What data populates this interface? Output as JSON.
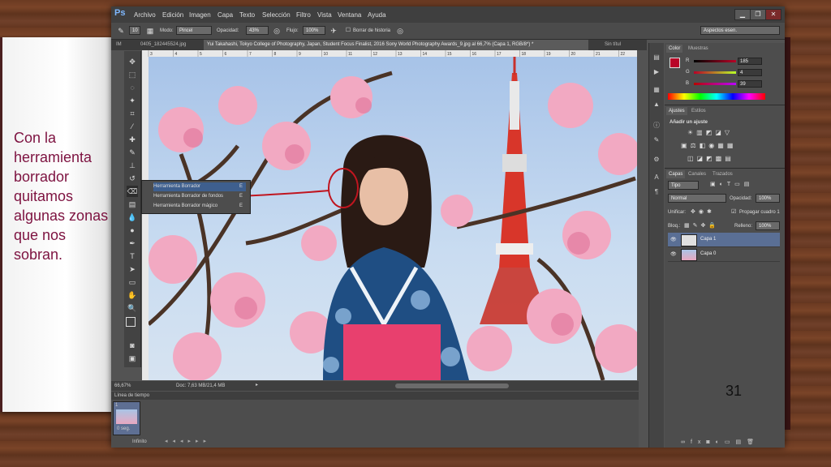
{
  "slide": {
    "text": "Con la herramienta borrador quitamos algunas zonas que nos sobran.",
    "page_number": "31"
  },
  "menu": {
    "logo": "Ps",
    "items": [
      "Archivo",
      "Edición",
      "Imagen",
      "Capa",
      "Texto",
      "Selección",
      "Filtro",
      "Vista",
      "Ventana",
      "Ayuda"
    ]
  },
  "options_bar": {
    "brush_size": "10",
    "modo_label": "Modo:",
    "modo_value": "Pincel",
    "opacidad_label": "Opacidad:",
    "opacidad_value": "43%",
    "flujo_label": "Flujo:",
    "flujo_value": "100%",
    "borrar_historia": "Borrar de historia",
    "workspace": "Aspectos esen."
  },
  "tabs": [
    {
      "label": "IM"
    },
    {
      "label": "0405_182445524.jpg"
    },
    {
      "label": "Yui Takahashi, Tokyo College of Photography, Japan, Student Focus Finalist, 2016 Sony World Photography Awards_9.jpg al 66,7% (Capa 1, RGB/8*) *"
    },
    {
      "label": "Sin títul"
    }
  ],
  "ruler_ticks": [
    "3",
    "4",
    "5",
    "6",
    "7",
    "8",
    "9",
    "10",
    "11",
    "12",
    "13",
    "14",
    "15",
    "16",
    "17",
    "18",
    "19",
    "20",
    "21",
    "22"
  ],
  "flyout": [
    {
      "label": "Herramienta Borrador",
      "key": "E"
    },
    {
      "label": "Herramienta Borrador de fondos",
      "key": "E"
    },
    {
      "label": "Herramienta Borrador mágico",
      "key": "E"
    }
  ],
  "status": {
    "zoom": "66,67%",
    "doc": "Doc: 7,63 MB/21,4 MB"
  },
  "timeline": {
    "title": "Línea de tiempo",
    "frame_number": "1",
    "frame_time": "0 seg.",
    "loop": "Infinito"
  },
  "color_panel": {
    "tabs": [
      "Color",
      "Muestras"
    ],
    "channels": [
      {
        "label": "R",
        "value": "185",
        "color": "#b90427"
      },
      {
        "label": "G",
        "value": "4",
        "color": "#04e04a"
      },
      {
        "label": "B",
        "value": "39",
        "color": "#2c2cff"
      }
    ]
  },
  "adjustments_panel": {
    "tabs": [
      "Ajustes",
      "Estilos"
    ],
    "title": "Añadir un ajuste"
  },
  "layers_panel": {
    "tabs": [
      "Capas",
      "Canales",
      "Trazados"
    ],
    "filter": "Tipo",
    "blend": "Normal",
    "opacity_label": "Opacidad:",
    "opacity_value": "100%",
    "unify_label": "Unificar:",
    "propagate": "Propagar cuadro 1",
    "lock_label": "Bloq.:",
    "fill_label": "Relleno:",
    "fill_value": "100%",
    "layers": [
      {
        "name": "Capa 1",
        "selected": true
      },
      {
        "name": "Capa 0",
        "selected": false
      }
    ]
  },
  "colors": {
    "foreground": "#b90427",
    "background": "#000000",
    "slide_text": "#7d1240"
  }
}
